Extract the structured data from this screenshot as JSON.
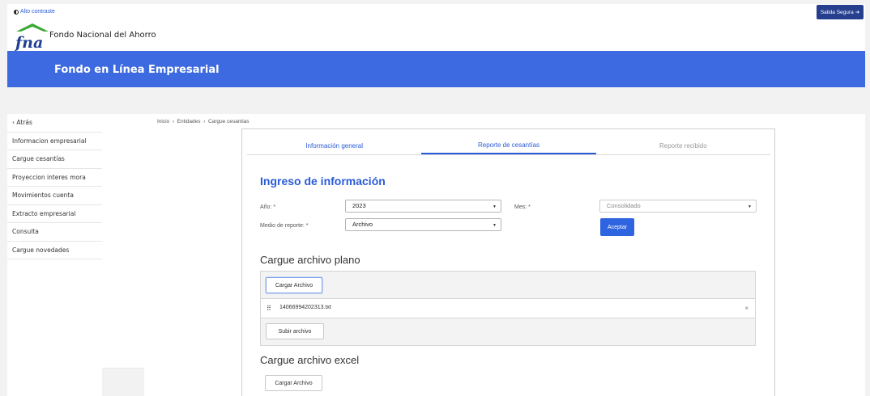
{
  "topbar": {
    "contrast_label": "Alto contraste",
    "logout_label": "Salida Segura",
    "logo_text": "fna",
    "brand_name": "Fondo Nacional del Ahorro"
  },
  "banner": {
    "title": "Fondo en Línea Empresarial"
  },
  "sidebar": {
    "items": [
      {
        "label": "‹ Atrás"
      },
      {
        "label": "Informacion empresarial"
      },
      {
        "label": "Cargue cesantías"
      },
      {
        "label": "Proyeccion interes mora"
      },
      {
        "label": "Movimientos cuenta"
      },
      {
        "label": "Extracto empresarial"
      },
      {
        "label": "Consulta"
      },
      {
        "label": "Cargue novedades"
      }
    ]
  },
  "breadcrumb": {
    "home": "Inicio",
    "sep": "›",
    "entities": "Entidades",
    "current": "Cargue cesantias"
  },
  "tabs": [
    {
      "label": "Información general"
    },
    {
      "label": "Reporte de cesantías"
    },
    {
      "label": "Reporte recibido"
    }
  ],
  "form": {
    "title": "Ingreso de información",
    "year_label": "Año: *",
    "year_value": "2023",
    "month_label": "Mes: *",
    "month_value": "Consolidado",
    "medium_label": "Medio de reporte: *",
    "medium_value": "Archivo",
    "accept_label": "Aceptar"
  },
  "plain_upload": {
    "title": "Cargue archivo plano",
    "load_label": "Cargar Archivo",
    "file_name": "14066994202313.txt",
    "upload_label": "Subir archivo"
  },
  "excel_upload": {
    "title": "Cargue archivo excel",
    "load_label": "Cargar Archivo"
  },
  "colors": {
    "primary": "#2f64e0",
    "banner": "#3d6ae0",
    "logout": "#253f8e",
    "logo_green": "#3aa935"
  }
}
